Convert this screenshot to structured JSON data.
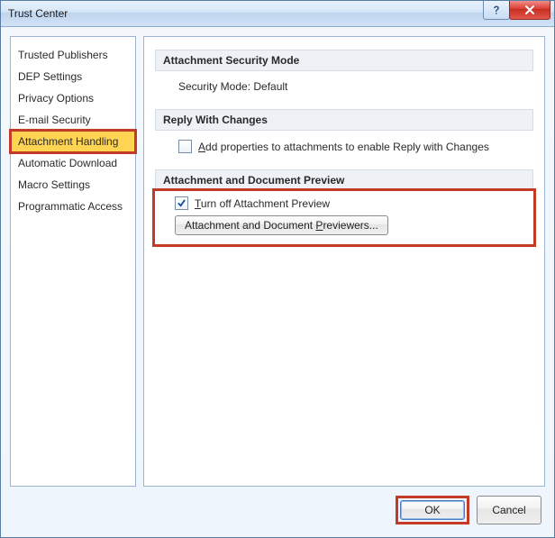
{
  "window": {
    "title": "Trust Center"
  },
  "sidebar": {
    "items": [
      {
        "label": "Trusted Publishers"
      },
      {
        "label": "DEP Settings"
      },
      {
        "label": "Privacy Options"
      },
      {
        "label": "E-mail Security"
      },
      {
        "label": "Attachment Handling"
      },
      {
        "label": "Automatic Download"
      },
      {
        "label": "Macro Settings"
      },
      {
        "label": "Programmatic Access"
      }
    ],
    "selected_index": 4
  },
  "sections": {
    "security_mode": {
      "header": "Attachment Security Mode",
      "line": "Security Mode: Default"
    },
    "reply": {
      "header": "Reply With Changes",
      "checkbox_label": "Add properties to attachments to enable Reply with Changes",
      "checked": false
    },
    "preview": {
      "header": "Attachment and Document Preview",
      "turn_off_label": "Turn off Attachment Preview",
      "turn_off_checked": true,
      "previewers_pre": "Attachment and Document ",
      "previewers_u": "P",
      "previewers_post": "reviewers..."
    }
  },
  "footer": {
    "ok": "OK",
    "cancel": "Cancel"
  }
}
